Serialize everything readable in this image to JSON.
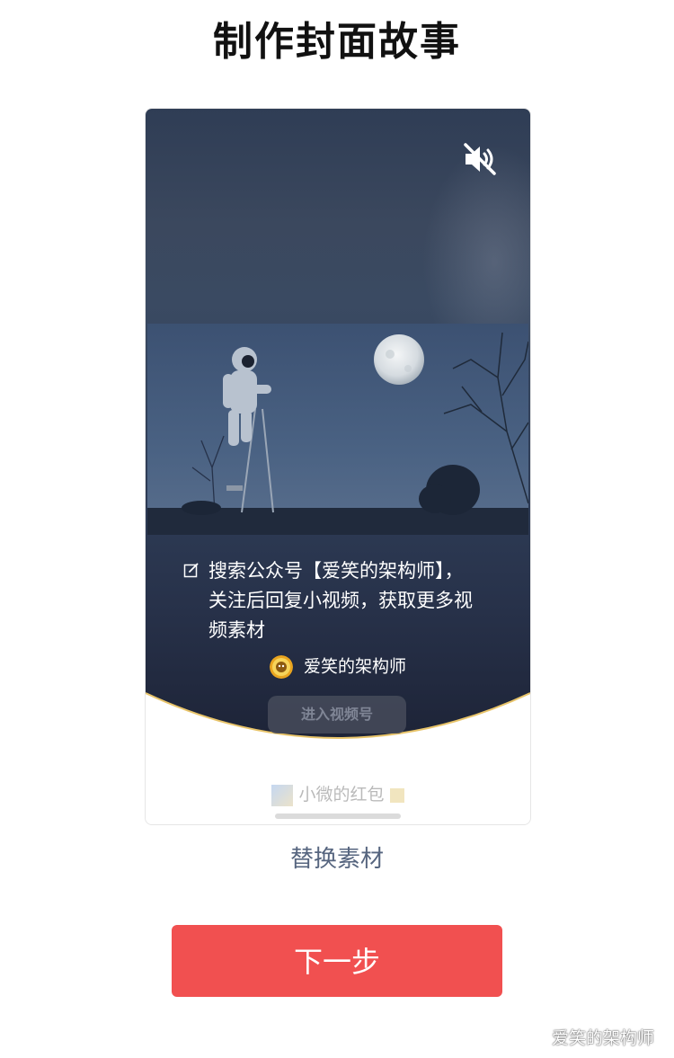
{
  "page": {
    "title": "制作封面故事"
  },
  "cover": {
    "mute_icon": "speaker-muted-icon",
    "caption_icon": "edit-icon",
    "caption": "搜索公众号【爱笑的架构师】，\n关注后回复小视频，获取更多视\n频素材",
    "account_name": "爱笑的架构师",
    "enter_button_label": "进入视频号",
    "curve_accent_color": "#e8c46a",
    "background_color": "#2e3c56"
  },
  "below_card": {
    "name": "小微的红包"
  },
  "actions": {
    "replace_label": "替换素材",
    "next_label": "下一步",
    "next_color": "#f15050"
  },
  "watermark": {
    "text": "爱笑的架构师"
  }
}
